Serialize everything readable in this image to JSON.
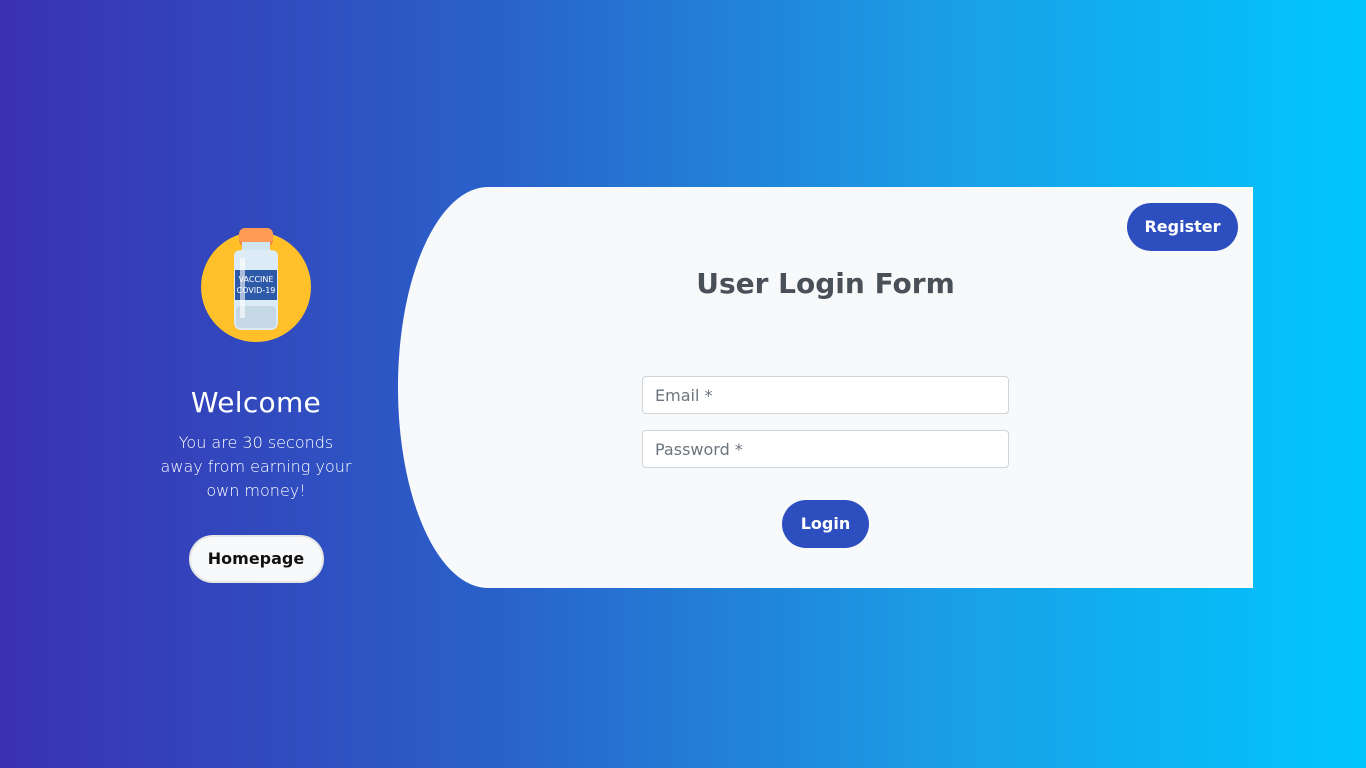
{
  "left_panel": {
    "logo_icon": "vaccine-bottle-icon",
    "logo_label_line1": "VACCINE",
    "logo_label_line2": "COVID-19",
    "welcome": "Welcome",
    "subtitle": "You are 30 seconds away from earning your own money!",
    "homepage_label": "Homepage"
  },
  "form": {
    "register_label": "Register",
    "title": "User Login Form",
    "email_placeholder": "Email *",
    "password_placeholder": "Password *",
    "login_label": "Login"
  },
  "colors": {
    "gradient_start": "#3a31b2",
    "gradient_end": "#00c6ff",
    "primary_button": "#2c4ebf",
    "card_background": "#f8f9fa",
    "logo_background": "#ffc02a"
  }
}
